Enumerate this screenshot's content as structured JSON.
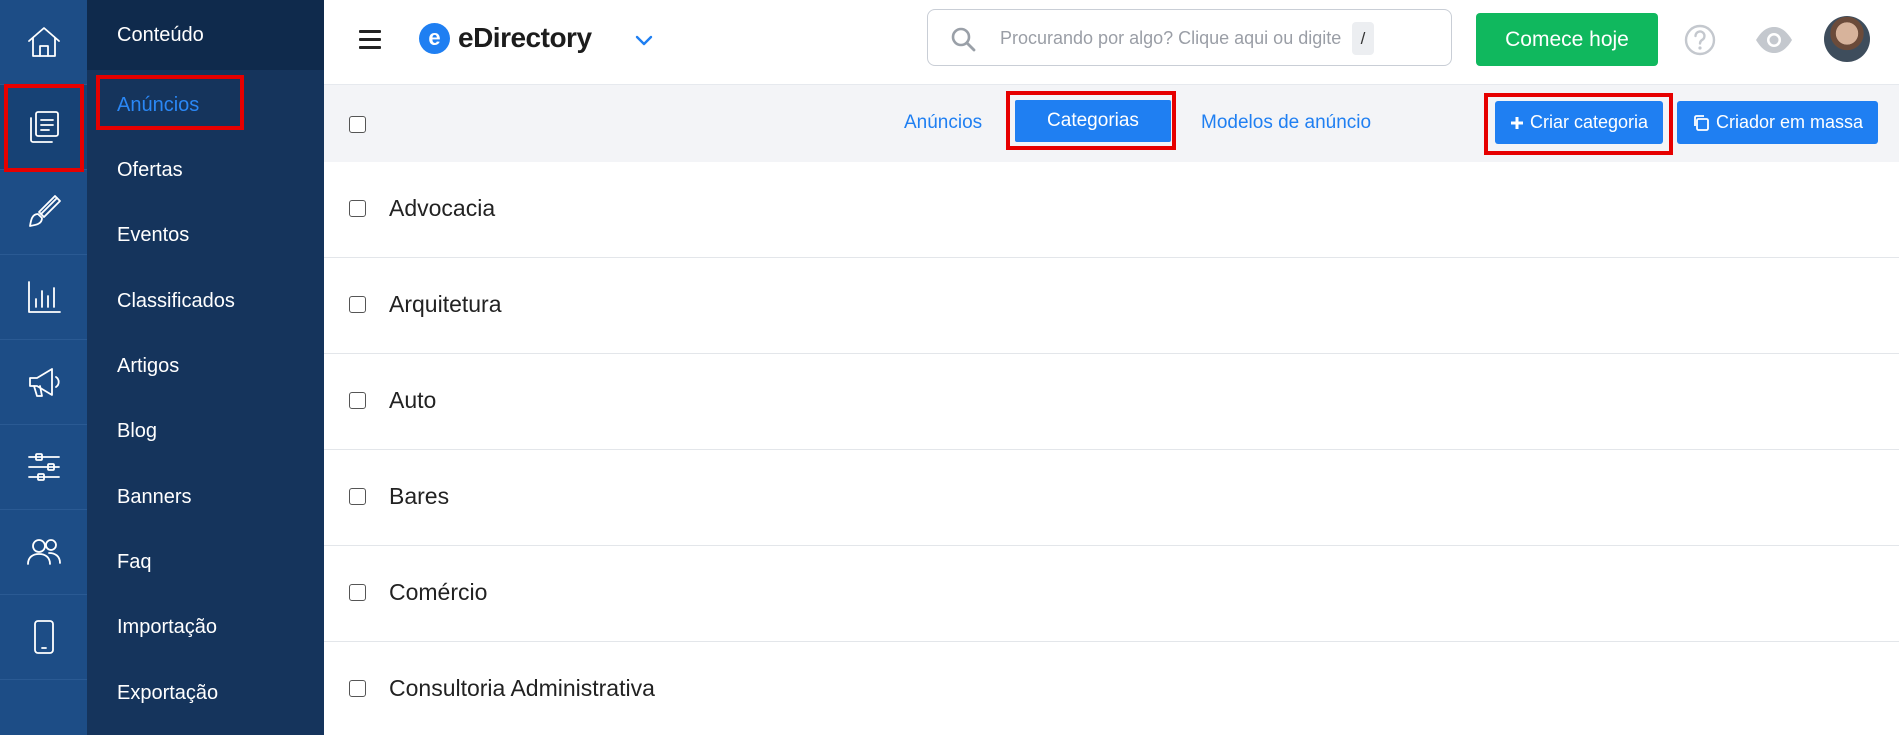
{
  "sidebar": {
    "header": "Conteúdo",
    "items": [
      {
        "label": "Anúncios",
        "active": true
      },
      {
        "label": "Ofertas"
      },
      {
        "label": "Eventos"
      },
      {
        "label": "Classificados"
      },
      {
        "label": "Artigos"
      },
      {
        "label": "Blog"
      },
      {
        "label": "Banners"
      },
      {
        "label": "Faq"
      },
      {
        "label": "Importação"
      },
      {
        "label": "Exportação"
      }
    ]
  },
  "rail": {
    "icons": [
      "home-icon",
      "content-icon",
      "brush-icon",
      "chart-icon",
      "megaphone-icon",
      "sliders-icon",
      "users-icon",
      "mobile-icon"
    ]
  },
  "header": {
    "brand": "eDirectory",
    "brand_mark": "e",
    "search_placeholder": "Procurando por algo? Clique aqui ou digite",
    "search_shortcut": "/",
    "cta_label": "Comece hoje"
  },
  "toolbar": {
    "tabs": [
      "Anúncios",
      "Categorias",
      "Modelos de anúncio"
    ],
    "active_tab": "Categorias",
    "create_label": "Criar categoria",
    "bulk_label": "Criador em massa"
  },
  "categories": [
    "Advocacia",
    "Arquitetura",
    "Auto",
    "Bares",
    "Comércio",
    "Consultoria Administrativa"
  ],
  "colors": {
    "accent": "#1f7ff2",
    "cta": "#10b85e",
    "rail": "#1d4d86",
    "sidebar": "#15345c",
    "highlight": "#e60000"
  }
}
